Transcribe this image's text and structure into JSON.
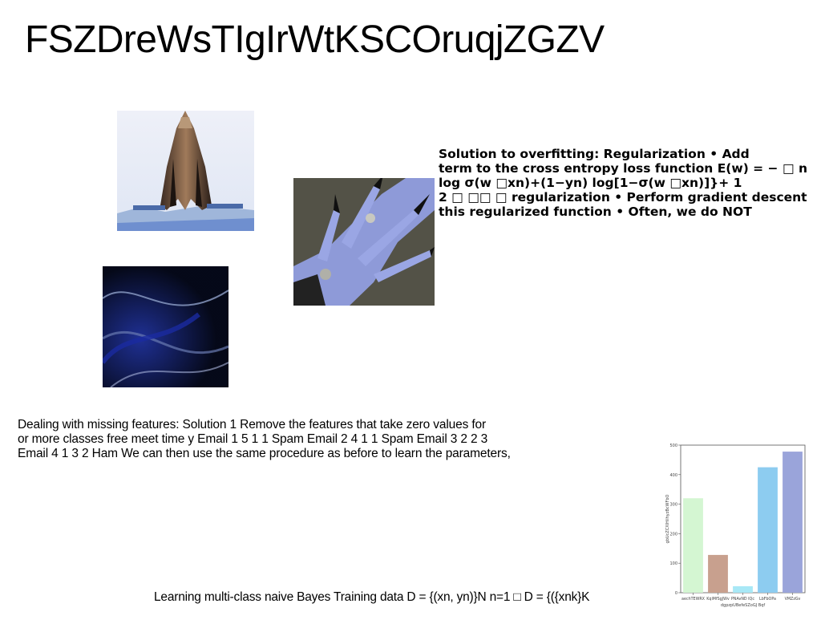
{
  "page": {
    "title": "FSZDreWsTIgIrWtKSCOruqjZGZV"
  },
  "images": [
    {
      "name": "tower-sculpture-photo",
      "description": "photo"
    },
    {
      "name": "blue-hand-photo",
      "description": "photo"
    },
    {
      "name": "abstract-wave-image",
      "description": "image"
    }
  ],
  "bold_block": {
    "lines": [
      "Solution to overfitting: Regularization • Add",
      "term to the cross entropy loss function E(w) = − □ n",
      "log σ(w □xn)+(1−yn) log[1−σ(w □xn)]}+ 1",
      "2 □ □□ □ regularization • Perform gradient descent",
      "this regularized function • Often, we do NOT"
    ]
  },
  "missing_block": {
    "lines": [
      "Dealing with missing features: Solution 1 Remove the features that take zero values for",
      "or more classes free meet time y Email 1 5 1 1 Spam Email 2 4 1 1 Spam Email 3 2 2 3",
      "Email 4 1 3 2 Ham We can then use the same procedure as before to learn the parameters,"
    ]
  },
  "bayes_line": "Learning multi-class naive Bayes Training data D = {(xn, yn)}N n=1 □ D = {({xnk}K",
  "chart_data": {
    "type": "bar",
    "categories": [
      "aechTEWRX",
      "KqiMfSgJWv",
      "PNAvND IQc",
      "LbFbOPa",
      "VMZzGv"
    ],
    "values": [
      320,
      128,
      22,
      425,
      478
    ],
    "colors": [
      "#d4f6d2",
      "#c8a08e",
      "#a8e8f6",
      "#8dccf0",
      "#9aa4da"
    ],
    "xlabel": "dgpzpUBefeSZoGJ Bqf",
    "ylabel": "gbUcZCXIHilhyzBcWFbO",
    "yticks": [
      0,
      100,
      200,
      300,
      400,
      500
    ],
    "ylim": [
      0,
      500
    ],
    "grid": false
  }
}
